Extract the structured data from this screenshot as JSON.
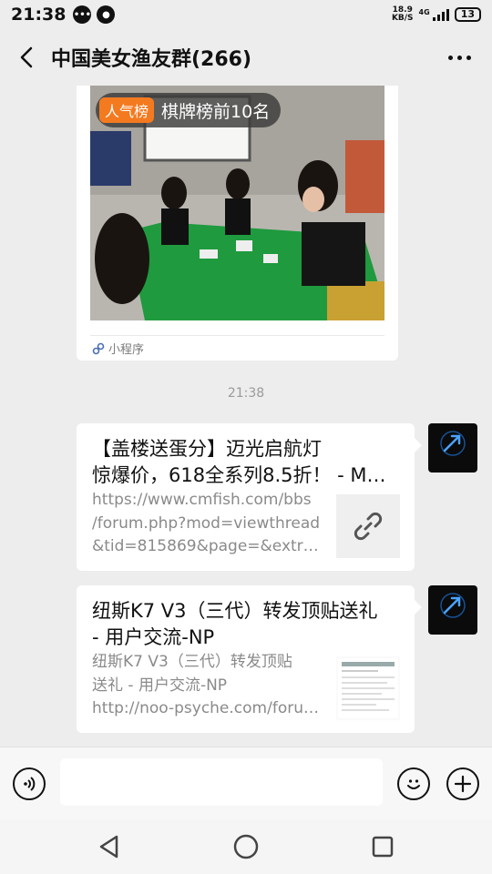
{
  "status_bar": {
    "time": "21:38",
    "net_speed_value": "18.9",
    "net_speed_unit": "KB/S",
    "network": "4G",
    "battery": "13"
  },
  "header": {
    "title": "中国美女渔友群(266)"
  },
  "mini_program": {
    "tag_badge": "人气榜",
    "tag_text": "棋牌榜前10名",
    "footer_label": "小程序"
  },
  "timestamp": "21:38",
  "messages": [
    {
      "title_line1": "【盖楼送蛋分】迈光启航灯",
      "title_line2": "惊爆价，618全系列8.5折！ - M…",
      "desc_line1": "https://www.cmfish.com/bbs",
      "desc_line2": "/forum.php?mod=viewthread",
      "desc_line3": "&tid=815869&page=&extra=…",
      "thumbnail": "link-icon"
    },
    {
      "title_line1": "纽斯K7 V3（三代）转发顶贴送礼",
      "title_line2": "- 用户交流-NP",
      "desc_line1": "纽斯K7 V3（三代）转发顶贴",
      "desc_line2": "送礼 - 用户交流-NP",
      "desc_line3": "http://noo-psyche.com/foru…",
      "thumbnail": "document-thumbnail"
    }
  ],
  "colors": {
    "background": "#ededed",
    "bubble": "#ffffff",
    "tag_badge": "#f47a1f",
    "avatar_bg": "#0b0b0b",
    "avatar_accent": "#4aa3ff"
  }
}
